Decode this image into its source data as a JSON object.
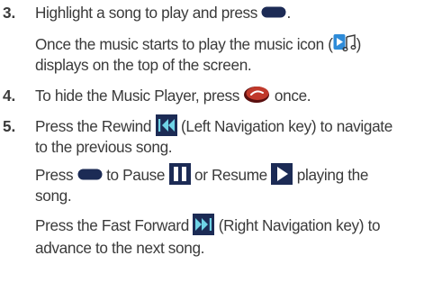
{
  "steps": [
    {
      "number": "3.",
      "lines": [
        {
          "before": "Highlight a song to play and press",
          "after": "."
        },
        {
          "before": "Once the music starts to play the music icon (",
          "after": ")"
        },
        {
          "text": "displays on the top of the screen."
        }
      ]
    },
    {
      "number": "4.",
      "lines": [
        {
          "before": "To hide the Music Player, press",
          "after": "once."
        }
      ]
    },
    {
      "number": "5.",
      "lines": [
        {
          "before": "Press the Rewind",
          "after": "(Left Navigation key) to navigate"
        },
        {
          "text": "to the previous song."
        },
        {
          "before": "Press",
          "mid1": "to Pause",
          "mid2": "or Resume",
          "after": "playing the"
        },
        {
          "text": "song."
        },
        {
          "before": "Press the Fast Forward",
          "after": "(Right Navigation key) to"
        },
        {
          "text": "advance to the next song."
        }
      ]
    }
  ],
  "colors": {
    "text": "#3a3a3a",
    "icon_navy": "#1c2b55",
    "end_key_red": "#c0392b",
    "music_icon_blue": "#2e8bd8"
  },
  "icons": {
    "center_key": "center-key-icon",
    "music": "music-icon",
    "end_key": "end-key-icon",
    "rewind": "rewind-icon",
    "pause": "pause-icon",
    "play": "play-icon",
    "fast_forward": "fast-forward-icon"
  }
}
